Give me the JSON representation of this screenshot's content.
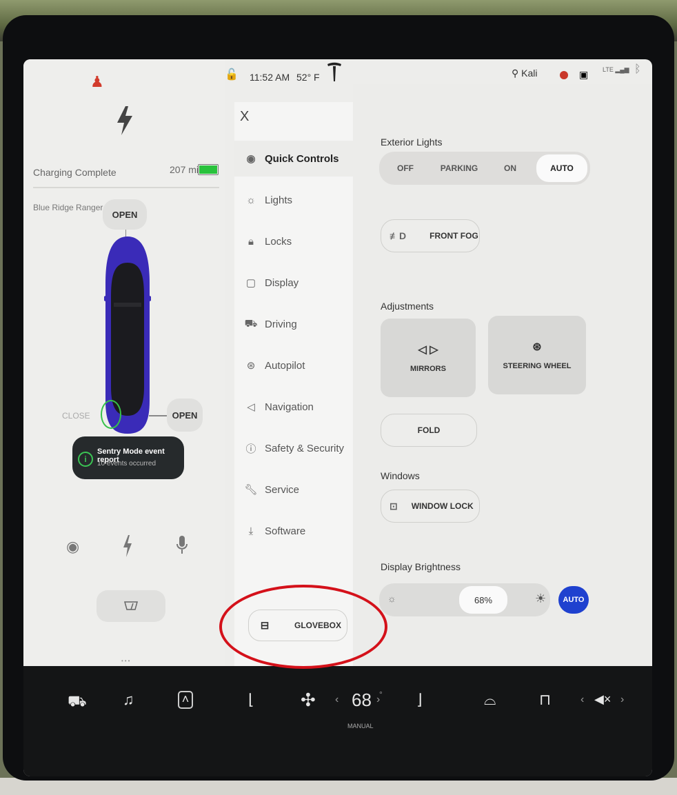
{
  "status_bar": {
    "time": "11:52 AM",
    "temperature": "52° F",
    "user": "Kali",
    "network": "LTE"
  },
  "vehicle_panel": {
    "charging_status": "Charging Complete",
    "range": "207 mi",
    "car_name": "Blue Ridge Ranger",
    "frunk_label": "OPEN",
    "charge_port_close_label": "CLOSE",
    "trunk_label": "OPEN",
    "notification": {
      "title": "Sentry Mode event report",
      "subtitle": "10 events occurred"
    }
  },
  "menu": {
    "close_label": "X",
    "items": [
      {
        "label": "Quick Controls",
        "icon": "toggle-icon"
      },
      {
        "label": "Lights",
        "icon": "lightbulb-icon"
      },
      {
        "label": "Locks",
        "icon": "lock-icon"
      },
      {
        "label": "Display",
        "icon": "display-icon"
      },
      {
        "label": "Driving",
        "icon": "car-icon"
      },
      {
        "label": "Autopilot",
        "icon": "steering-icon"
      },
      {
        "label": "Navigation",
        "icon": "navigation-arrow-icon"
      },
      {
        "label": "Safety & Security",
        "icon": "alert-icon"
      },
      {
        "label": "Service",
        "icon": "wrench-icon"
      },
      {
        "label": "Software",
        "icon": "download-icon"
      }
    ],
    "glovebox_label": "GLOVEBOX"
  },
  "quick_controls": {
    "exterior_lights": {
      "heading": "Exterior Lights",
      "options": [
        "OFF",
        "PARKING",
        "ON",
        "AUTO"
      ],
      "selected": "AUTO"
    },
    "front_fog_label": "FRONT FOG",
    "adjustments": {
      "heading": "Adjustments",
      "mirrors_label": "MIRRORS",
      "steering_wheel_label": "STEERING WHEEL",
      "fold_label": "FOLD"
    },
    "windows": {
      "heading": "Windows",
      "window_lock_label": "WINDOW LOCK"
    },
    "display_brightness": {
      "heading": "Display Brightness",
      "value": "68%",
      "auto_label": "AUTO"
    }
  },
  "dock": {
    "cabin_temperature": "68",
    "climate_mode": "MANUAL"
  },
  "colors": {
    "accent_blue": "#1f41cf",
    "battery_green": "#29c23c",
    "annotation_red": "#d4111a",
    "seatbelt_red": "#d23b2c"
  }
}
